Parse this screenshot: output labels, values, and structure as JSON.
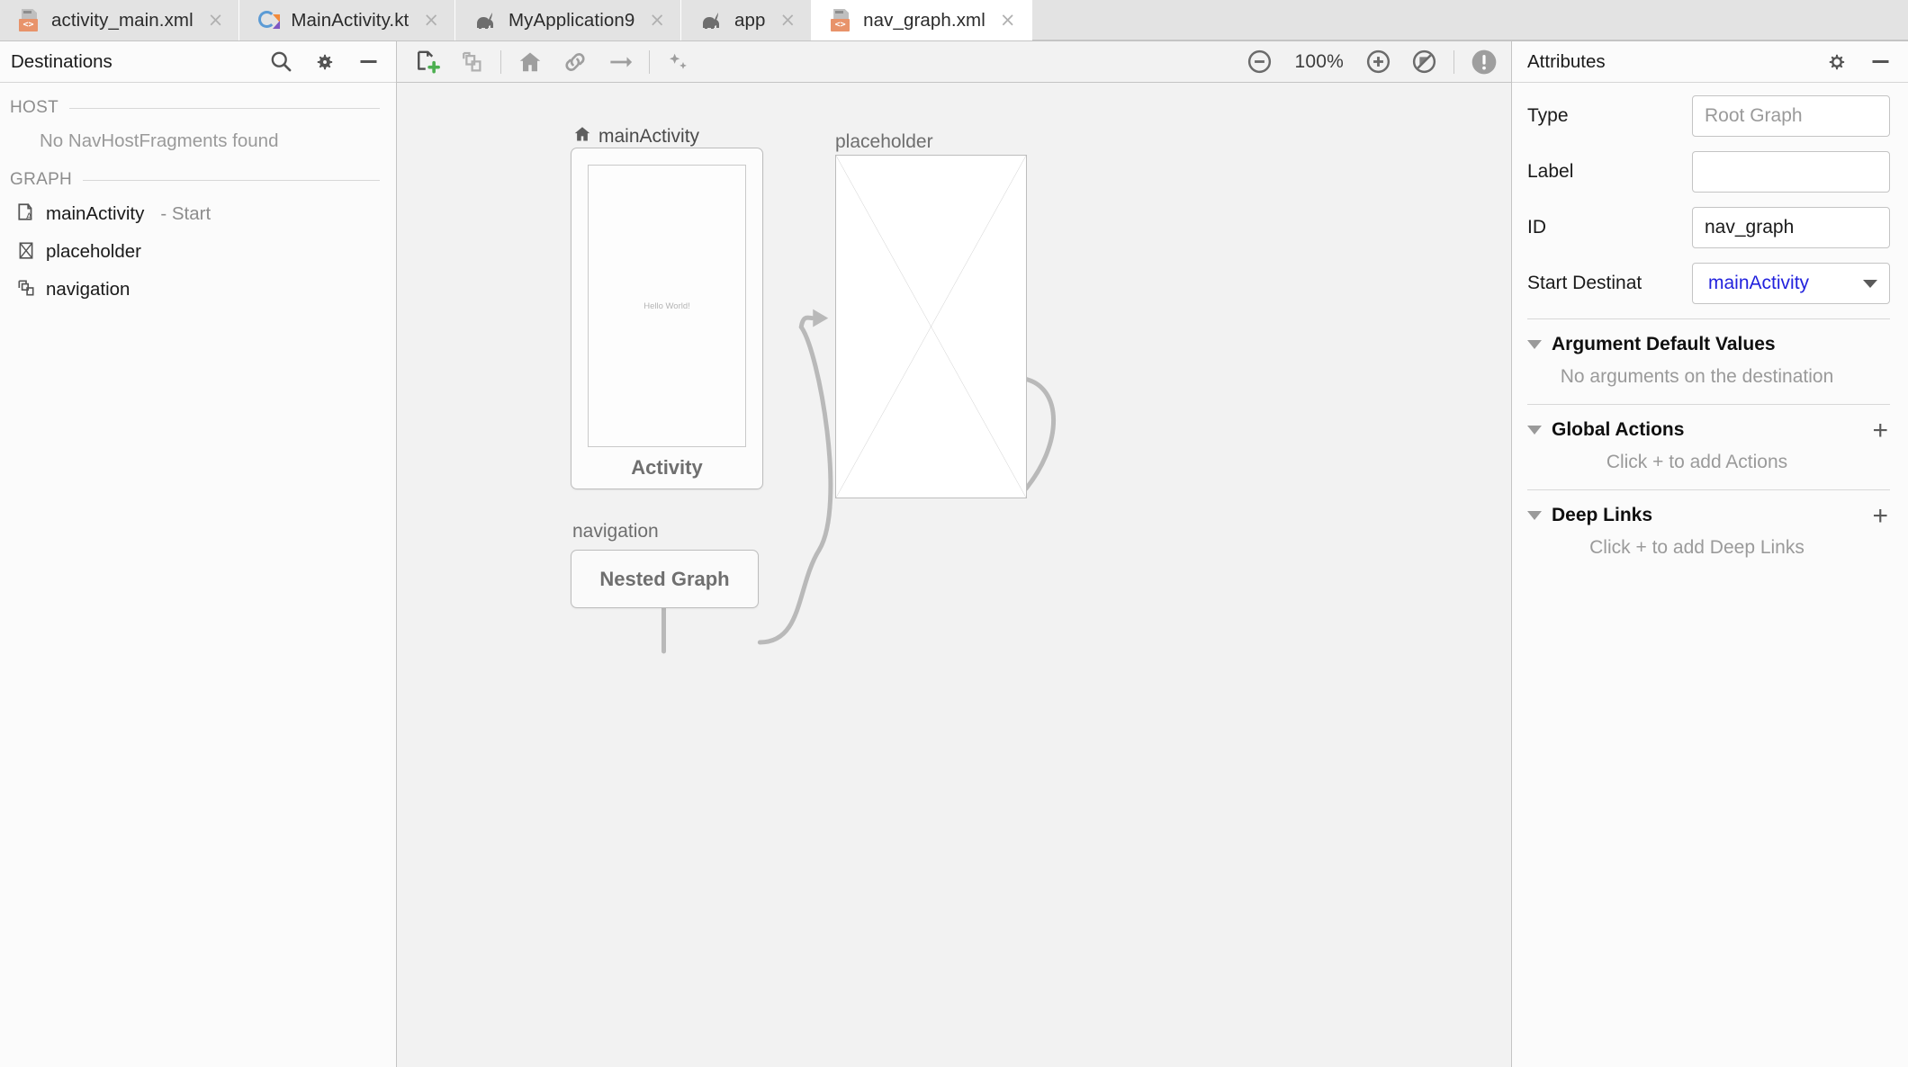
{
  "tabs": [
    {
      "label": "activity_main.xml",
      "icon": "xml-layout-icon",
      "active": false,
      "close": "×"
    },
    {
      "label": "MainActivity.kt",
      "icon": "kotlin-icon",
      "active": false,
      "close": "×"
    },
    {
      "label": "MyApplication9",
      "icon": "module-icon",
      "active": false,
      "close": "×"
    },
    {
      "label": "app",
      "icon": "module-icon",
      "active": false,
      "close": "×"
    },
    {
      "label": "nav_graph.xml",
      "icon": "xml-layout-icon",
      "active": true,
      "close": "×"
    }
  ],
  "left_panel": {
    "title": "Destinations",
    "header_icons": [
      "search-icon",
      "gear-icon",
      "minimize-icon"
    ],
    "sections": [
      {
        "title": "HOST",
        "empty_note": "No NavHostFragments found",
        "items": []
      },
      {
        "title": "GRAPH",
        "empty_note": "",
        "items": [
          {
            "label": "mainActivity",
            "sub": "- Start",
            "icon": "activity-icon"
          },
          {
            "label": "placeholder",
            "sub": "",
            "icon": "placeholder-icon"
          },
          {
            "label": "navigation",
            "sub": "",
            "icon": "nested-graph-icon"
          }
        ]
      }
    ]
  },
  "toolbar": {
    "new_destination": "new-destination-icon",
    "nested_graph": "nested-graph-icon",
    "home": "home-icon",
    "link": "link-icon",
    "arrow": "arrow-right-icon",
    "auto_arrange": "auto-arrange-icon",
    "zoom_out": "zoom-out-icon",
    "zoom_level": "100%",
    "zoom_in": "zoom-in-icon",
    "zoom_fit": "zoom-fit-icon",
    "issues": "warning-icon"
  },
  "canvas": {
    "main_activity": {
      "title": "mainActivity",
      "title_icon": "home-icon",
      "screen_text": "Hello World!",
      "caption": "Activity"
    },
    "placeholder": {
      "title": "placeholder"
    },
    "nested": {
      "title": "navigation",
      "caption": "Nested Graph"
    }
  },
  "right_panel": {
    "title": "Attributes",
    "header_icons": [
      "gear-icon",
      "minimize-icon"
    ],
    "fields": [
      {
        "label": "Type",
        "value": "Root Graph",
        "is_placeholder": true
      },
      {
        "label": "Label",
        "value": "",
        "is_placeholder": false
      },
      {
        "label": "ID",
        "value": "nav_graph",
        "is_placeholder": false
      }
    ],
    "start_destination": {
      "label": "Start Destinat",
      "value": "mainActivity"
    },
    "groups": [
      {
        "title": "Argument Default Values",
        "note": "No arguments on the destination",
        "add": ""
      },
      {
        "title": "Global Actions",
        "note": "Click + to add Actions",
        "add": "+"
      },
      {
        "title": "Deep Links",
        "note": "Click + to add Deep Links",
        "add": "+"
      }
    ]
  },
  "colors": {
    "accent_blue": "#2222dd",
    "green_plus": "#4caf50",
    "orange_xml": "#e8936a",
    "panel_bg": "#fbfbfb",
    "canvas_bg": "#f2f2f2"
  }
}
